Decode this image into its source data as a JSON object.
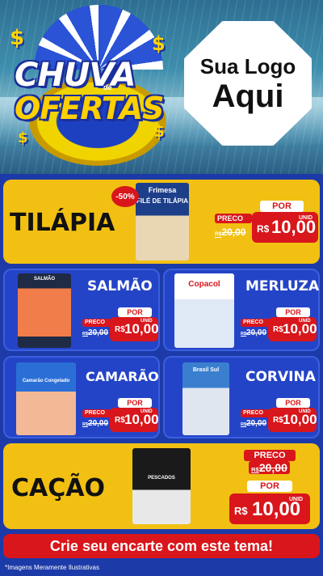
{
  "header": {
    "title_line1": "CHUVA",
    "title_de": "de",
    "title_line2": "OFERTAS",
    "logo_line1": "Sua Logo",
    "logo_line2": "Aqui"
  },
  "featured": {
    "name": "TILÁPIA",
    "discount_badge": "-50%",
    "package_brand": "Frimesa",
    "package_title": "FILÉ DE TILÁPIA",
    "preco_label": "PRECO",
    "old_price_currency": "R$",
    "old_price": "20,00",
    "por_label": "POR",
    "new_price_currency": "R$",
    "new_price": "10,00",
    "unit": "UNID"
  },
  "products": [
    {
      "name": "SALMÃO",
      "package_text": "SALMÃO",
      "preco_label": "PRECO",
      "old_currency": "R$",
      "old_price": "20,00",
      "por_label": "POR",
      "currency": "R$",
      "price": "10,00",
      "unit": "UNID"
    },
    {
      "name": "MERLUZA",
      "package_text": "Copacol",
      "preco_label": "PRECO",
      "old_currency": "R$",
      "old_price": "20,00",
      "por_label": "POR",
      "currency": "R$",
      "price": "10,00",
      "unit": "UNID"
    },
    {
      "name": "CAMARÃO",
      "package_text": "Camarão Congelado",
      "preco_label": "PRECO",
      "old_currency": "R$",
      "old_price": "20,00",
      "por_label": "POR",
      "currency": "R$",
      "price": "10,00",
      "unit": "UNID"
    },
    {
      "name": "CORVINA",
      "package_text": "Brasil Sul",
      "preco_label": "PRECO",
      "old_currency": "R$",
      "old_price": "20,00",
      "por_label": "POR",
      "currency": "R$",
      "price": "10,00",
      "unit": "UNID"
    }
  ],
  "bottom_feature": {
    "name": "CAÇÃO",
    "package_text": "PESCADOS",
    "preco_label": "PRECO",
    "old_currency": "R$",
    "old_price": "20,00",
    "por_label": "POR",
    "currency": "R$",
    "price": "10,00",
    "unit": "UNID"
  },
  "cta": {
    "label": "Crie seu encarte com este tema!"
  },
  "footnote": "*Imagens Meramente Ilustrativas",
  "colors": {
    "background": "#1c3aa8",
    "accent_yellow": "#f2c013",
    "accent_red": "#d8161b"
  }
}
